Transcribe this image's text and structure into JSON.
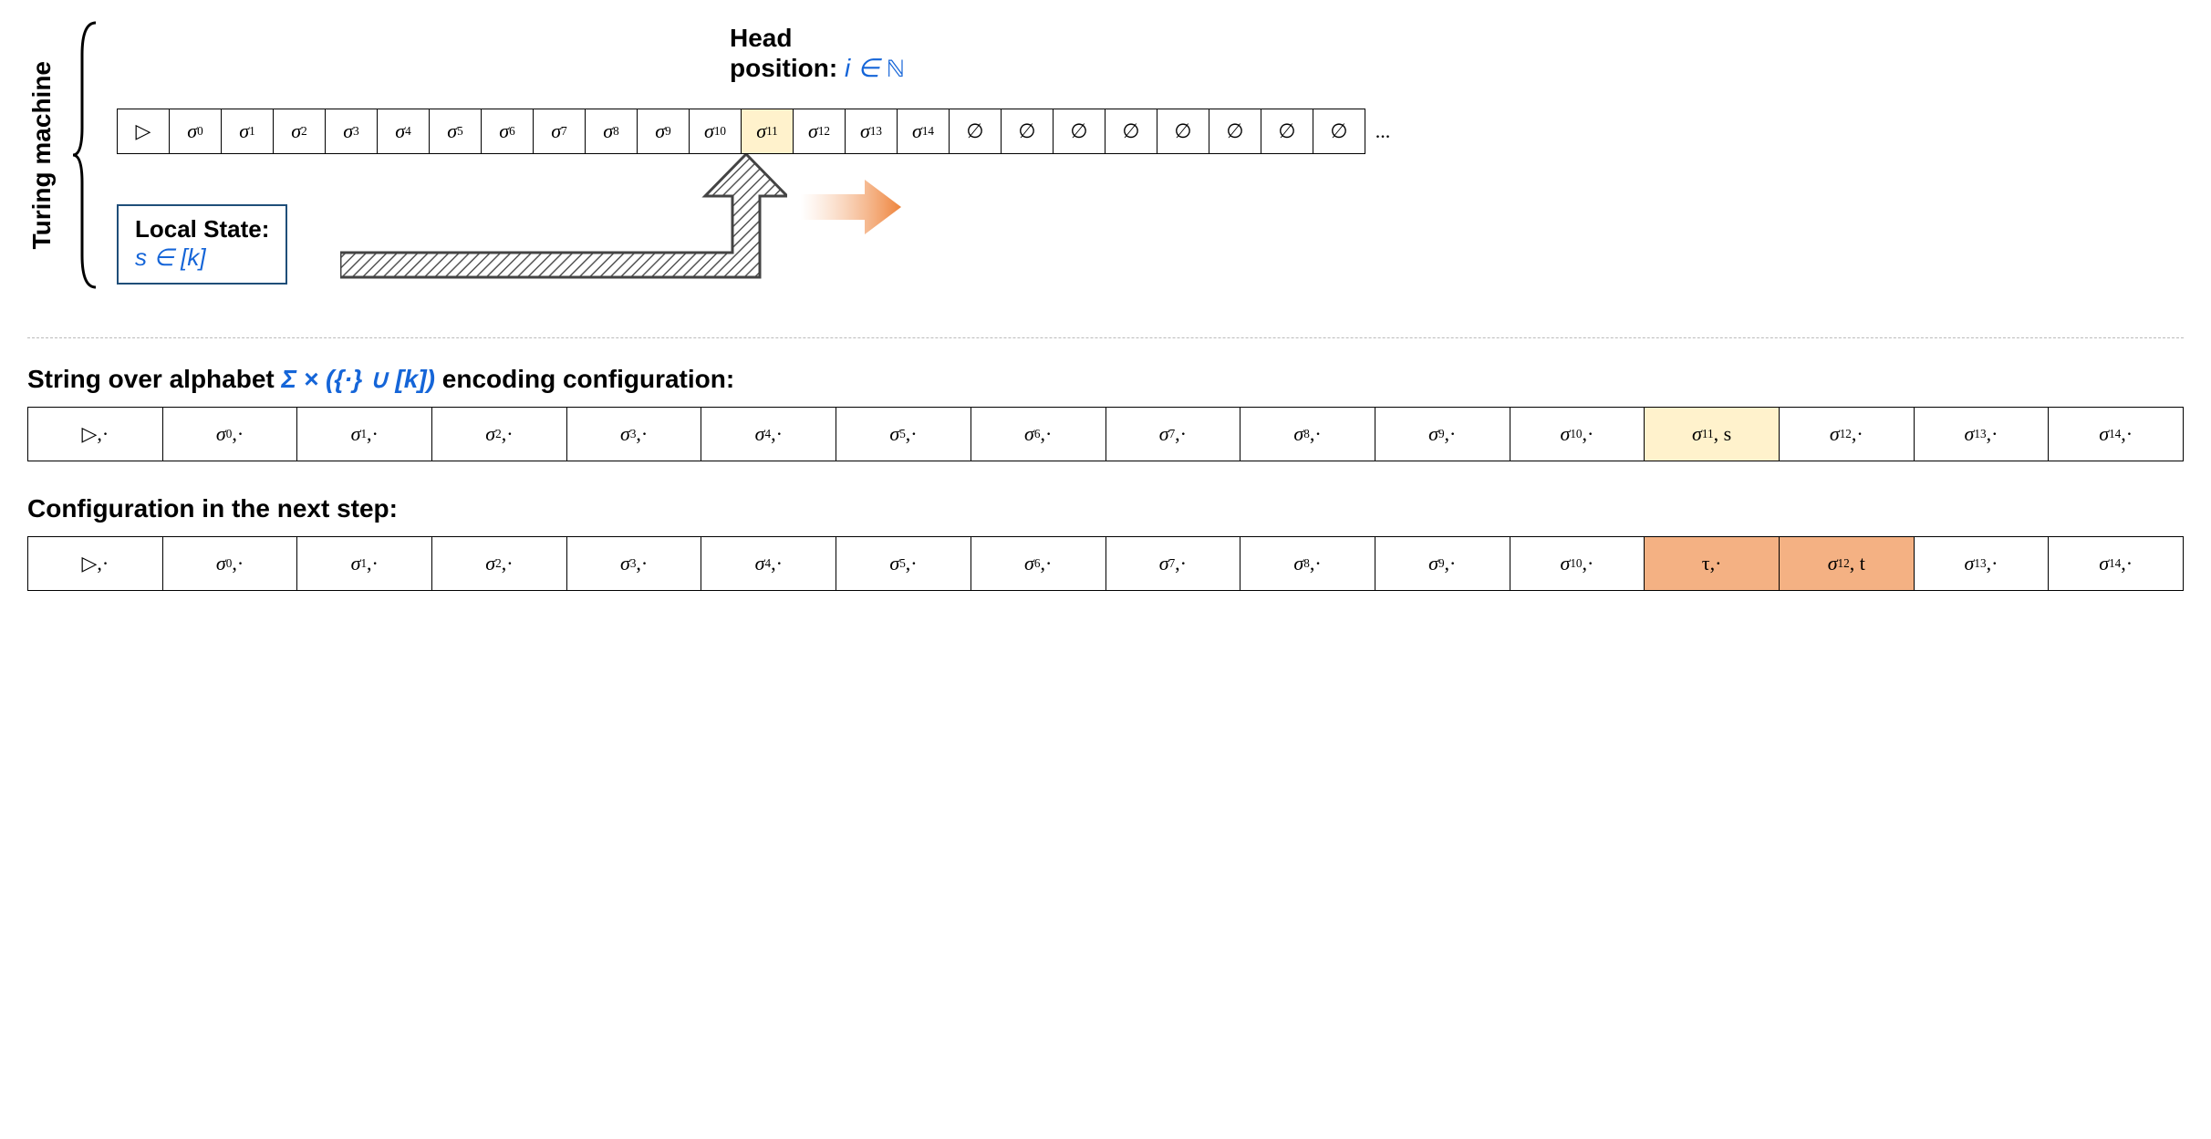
{
  "top": {
    "vertical_label": "Turing machine",
    "head_label_line1": "Head",
    "head_label_line2": "position: ",
    "head_math": "i ∈ ℕ",
    "tape": [
      {
        "t": "▷"
      },
      {
        "t": "σ",
        "sub": "0"
      },
      {
        "t": "σ",
        "sub": "1"
      },
      {
        "t": "σ",
        "sub": "2"
      },
      {
        "t": "σ",
        "sub": "3"
      },
      {
        "t": "σ",
        "sub": "4"
      },
      {
        "t": "σ",
        "sub": "5"
      },
      {
        "t": "σ",
        "sub": "6"
      },
      {
        "t": "σ",
        "sub": "7"
      },
      {
        "t": "σ",
        "sub": "8"
      },
      {
        "t": "σ",
        "sub": "9"
      },
      {
        "t": "σ",
        "sub": "10"
      },
      {
        "t": "σ",
        "sub": "11",
        "hl": "yellow"
      },
      {
        "t": "σ",
        "sub": "12"
      },
      {
        "t": "σ",
        "sub": "13"
      },
      {
        "t": "σ",
        "sub": "14"
      },
      {
        "t": "∅"
      },
      {
        "t": "∅"
      },
      {
        "t": "∅"
      },
      {
        "t": "∅"
      },
      {
        "t": "∅"
      },
      {
        "t": "∅"
      },
      {
        "t": "∅"
      },
      {
        "t": "∅"
      },
      {
        "t": "...",
        "dots": true
      }
    ],
    "state_label": "Local State:",
    "state_math": "s ∈ [k]"
  },
  "row1": {
    "label_prefix": "String over alphabet  ",
    "label_math": "Σ × ({·} ∪ [k])",
    "label_suffix": " encoding configuration:",
    "cells": [
      {
        "t": "▷,·"
      },
      {
        "t": "σ",
        "sub": "0",
        "suf": ",·"
      },
      {
        "t": "σ",
        "sub": "1",
        "suf": ",·"
      },
      {
        "t": "σ",
        "sub": "2",
        "suf": ",·"
      },
      {
        "t": "σ",
        "sub": "3",
        "suf": ",·"
      },
      {
        "t": "σ",
        "sub": "4",
        "suf": ",·"
      },
      {
        "t": "σ",
        "sub": "5",
        "suf": ",·"
      },
      {
        "t": "σ",
        "sub": "6",
        "suf": ",·"
      },
      {
        "t": "σ",
        "sub": "7",
        "suf": ",·"
      },
      {
        "t": "σ",
        "sub": "8",
        "suf": ",·"
      },
      {
        "t": "σ",
        "sub": "9",
        "suf": ",·"
      },
      {
        "t": "σ",
        "sub": "10",
        "suf": ",·"
      },
      {
        "t": "σ",
        "sub": "11",
        "suf": ", s",
        "hl": "yellow"
      },
      {
        "t": "σ",
        "sub": "12",
        "suf": ",·"
      },
      {
        "t": "σ",
        "sub": "13",
        "suf": ",·"
      },
      {
        "t": "σ",
        "sub": "14",
        "suf": ",·"
      }
    ]
  },
  "row2": {
    "label": "Configuration in the next step:",
    "cells": [
      {
        "t": "▷,·"
      },
      {
        "t": "σ",
        "sub": "0",
        "suf": ",·"
      },
      {
        "t": "σ",
        "sub": "1",
        "suf": ",·"
      },
      {
        "t": "σ",
        "sub": "2",
        "suf": ",·"
      },
      {
        "t": "σ",
        "sub": "3",
        "suf": ",·"
      },
      {
        "t": "σ",
        "sub": "4",
        "suf": ",·"
      },
      {
        "t": "σ",
        "sub": "5",
        "suf": ",·"
      },
      {
        "t": "σ",
        "sub": "6",
        "suf": ",·"
      },
      {
        "t": "σ",
        "sub": "7",
        "suf": ",·"
      },
      {
        "t": "σ",
        "sub": "8",
        "suf": ",·"
      },
      {
        "t": "σ",
        "sub": "9",
        "suf": ",·"
      },
      {
        "t": "σ",
        "sub": "10",
        "suf": ",·"
      },
      {
        "t": "τ,·",
        "hl": "orange"
      },
      {
        "t": "σ",
        "sub": "12",
        "suf": ", t",
        "hl": "orange"
      },
      {
        "t": "σ",
        "sub": "13",
        "suf": ",·"
      },
      {
        "t": "σ",
        "sub": "14",
        "suf": ",·"
      }
    ]
  }
}
